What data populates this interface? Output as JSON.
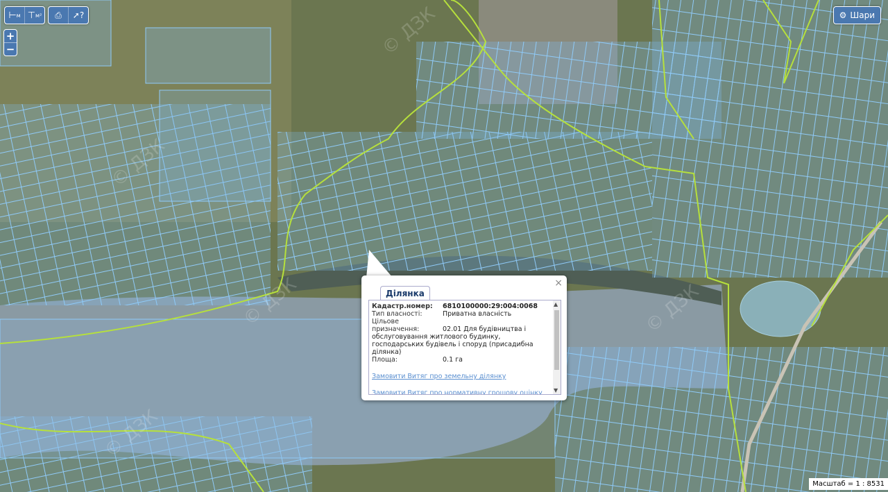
{
  "toolbar": {
    "measure_label": "м",
    "area_label": "м²",
    "print_icon": "print-icon",
    "info_icon": "info-cursor-icon"
  },
  "zoom": {
    "in_label": "+",
    "out_label": "−"
  },
  "layers_button": {
    "label": "Шари",
    "icon": "gear-icon"
  },
  "popup": {
    "tab_label": "Ділянка",
    "close_label": "×",
    "fields": [
      {
        "label": "Кадастр.номер:",
        "value": "6810100000:29:004:0068"
      },
      {
        "label": "Тип власності:",
        "value": "Приватна власність"
      },
      {
        "label": "Цільове призначення:",
        "value": "02.01 Для будівництва і обслуговування житлового будинку, господарських будівель і споруд (присадибна ділянка)"
      },
      {
        "label": "Площа:",
        "value": "0.1 га"
      }
    ],
    "links": [
      "Замовити Витяг про земельну ділянку",
      "Замовити Витяг про нормативну грошову оцінку"
    ]
  },
  "watermark": "© ДЗК",
  "scale_text": "Масштаб = 1 : 8531",
  "colors": {
    "parcel": "#6fb5f0",
    "boundary": "#b6e03c",
    "water": "#8ea3b0",
    "ui_blue": "#4a78b0"
  }
}
